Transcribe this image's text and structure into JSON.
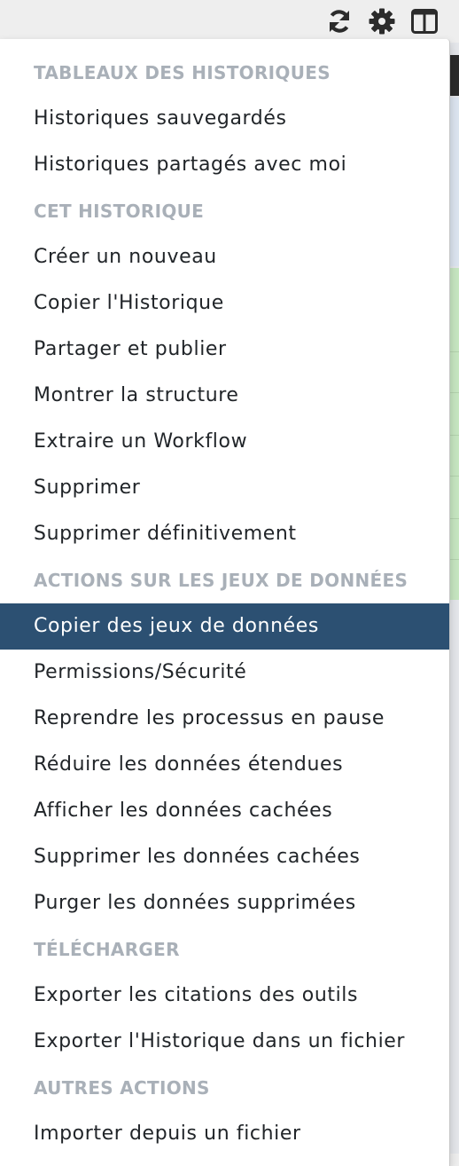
{
  "toolbar": {
    "icons": [
      "refresh-icon",
      "gear-icon",
      "columns-icon"
    ],
    "icon_color": "#2b2b2b"
  },
  "menu": {
    "accent_color": "#2c5072",
    "sections": [
      {
        "header": "TABLEAUX DES HISTORIQUES",
        "items": [
          "Historiques sauvegardés",
          "Historiques partagés avec moi"
        ]
      },
      {
        "header": "CET HISTORIQUE",
        "items": [
          "Créer un nouveau",
          "Copier l'Historique",
          "Partager et publier",
          "Montrer la structure",
          "Extraire un Workflow",
          "Supprimer",
          "Supprimer définitivement"
        ]
      },
      {
        "header": "ACTIONS SUR LES JEUX DE DONNÉES",
        "items": [
          "Copier des jeux de données",
          "Permissions/Sécurité",
          "Reprendre les processus en pause",
          "Réduire les données étendues",
          "Afficher les données cachées",
          "Supprimer les données cachées",
          "Purger les données supprimées"
        ]
      },
      {
        "header": "TÉLÉCHARGER",
        "items": [
          "Exporter les citations des outils",
          "Exporter l'Historique dans un fichier"
        ]
      },
      {
        "header": "AUTRES ACTIONS",
        "items": [
          "Importer depuis un fichier"
        ]
      }
    ],
    "active_item": "Copier des jeux de données"
  }
}
